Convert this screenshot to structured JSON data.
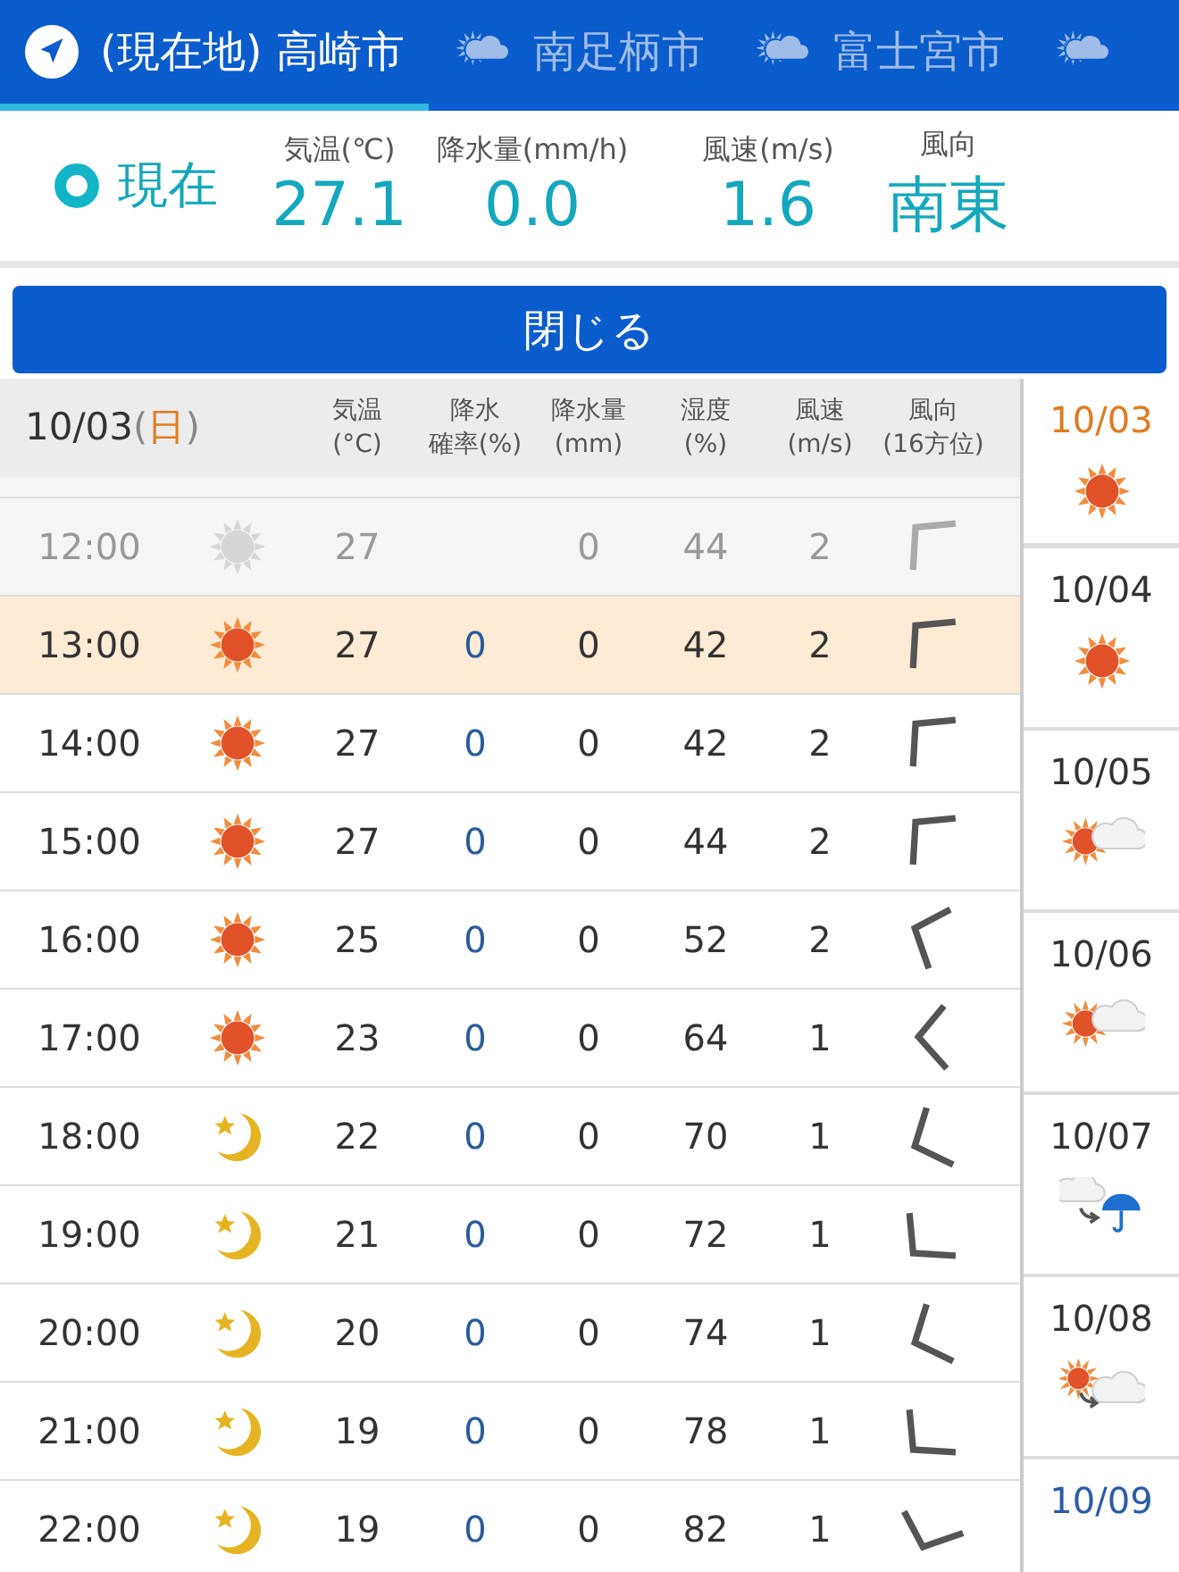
{
  "tabs": [
    {
      "label": "(現在地) 高崎市",
      "icon": {
        "kind": "location"
      },
      "selected": true
    },
    {
      "label": "南足柄市",
      "icon": {
        "kind": "sun_cloud"
      },
      "selected": false
    },
    {
      "label": "富士宮市",
      "icon": {
        "kind": "sun_cloud"
      },
      "selected": false
    },
    {
      "icon": {
        "kind": "sun_cloud"
      },
      "selected": false
    }
  ],
  "current": {
    "label": "現在",
    "stats": [
      {
        "label": "気温(℃)",
        "value": "27.1"
      },
      {
        "label": "降水量(mm/h)",
        "value": "0.0"
      },
      {
        "label": "風速(m/s)",
        "value": "1.6"
      },
      {
        "label": "風向",
        "value": "南東"
      }
    ]
  },
  "close_button": "閉じる",
  "table": {
    "date": "10/03",
    "weekday_open": "(",
    "weekday": "日",
    "weekday_close": ")",
    "columns": [
      {
        "top": "気温",
        "bottom": "(°C)"
      },
      {
        "top": "降水",
        "bottom": "確率(%)"
      },
      {
        "top": "降水量",
        "bottom": "(mm)"
      },
      {
        "top": "湿度",
        "bottom": "(%)"
      },
      {
        "top": "風速",
        "bottom": "(m/s)"
      },
      {
        "top": "風向",
        "bottom": "(16方位)"
      }
    ],
    "rows": [
      {
        "time": "12:00",
        "weather": {
          "kind": "sun"
        },
        "temp": "27",
        "amount": "0",
        "humidity": "44",
        "wind_speed": "2",
        "wind_icon": {
          "kind": "NW"
        },
        "past": true,
        "selected": false
      },
      {
        "time": "13:00",
        "weather": {
          "kind": "sun"
        },
        "temp": "27",
        "prob": "0",
        "amount": "0",
        "humidity": "42",
        "wind_speed": "2",
        "wind_icon": {
          "kind": "NW"
        },
        "past": false,
        "selected": true
      },
      {
        "time": "14:00",
        "weather": {
          "kind": "sun"
        },
        "temp": "27",
        "prob": "0",
        "amount": "0",
        "humidity": "42",
        "wind_speed": "2",
        "wind_icon": {
          "kind": "NW"
        },
        "past": false,
        "selected": false
      },
      {
        "time": "15:00",
        "weather": {
          "kind": "sun"
        },
        "temp": "27",
        "prob": "0",
        "amount": "0",
        "humidity": "44",
        "wind_speed": "2",
        "wind_icon": {
          "kind": "NW"
        },
        "past": false,
        "selected": false
      },
      {
        "time": "16:00",
        "weather": {
          "kind": "sun"
        },
        "temp": "25",
        "prob": "0",
        "amount": "0",
        "humidity": "52",
        "wind_speed": "2",
        "wind_icon": {
          "kind": "WNW"
        },
        "past": false,
        "selected": false
      },
      {
        "time": "17:00",
        "weather": {
          "kind": "sun"
        },
        "temp": "23",
        "prob": "0",
        "amount": "0",
        "humidity": "64",
        "wind_speed": "1",
        "wind_icon": {
          "kind": "W"
        },
        "past": false,
        "selected": false
      },
      {
        "time": "18:00",
        "weather": {
          "kind": "moon"
        },
        "temp": "22",
        "prob": "0",
        "amount": "0",
        "humidity": "70",
        "wind_speed": "1",
        "wind_icon": {
          "kind": "WSW"
        },
        "past": false,
        "selected": false
      },
      {
        "time": "19:00",
        "weather": {
          "kind": "moon"
        },
        "temp": "21",
        "prob": "0",
        "amount": "0",
        "humidity": "72",
        "wind_speed": "1",
        "wind_icon": {
          "kind": "SW"
        },
        "past": false,
        "selected": false
      },
      {
        "time": "20:00",
        "weather": {
          "kind": "moon"
        },
        "temp": "20",
        "prob": "0",
        "amount": "0",
        "humidity": "74",
        "wind_speed": "1",
        "wind_icon": {
          "kind": "WSW"
        },
        "past": false,
        "selected": false
      },
      {
        "time": "21:00",
        "weather": {
          "kind": "moon"
        },
        "temp": "19",
        "prob": "0",
        "amount": "0",
        "humidity": "78",
        "wind_speed": "1",
        "wind_icon": {
          "kind": "SW"
        },
        "past": false,
        "selected": false
      },
      {
        "time": "22:00",
        "weather": {
          "kind": "moon"
        },
        "temp": "19",
        "prob": "0",
        "amount": "0",
        "humidity": "82",
        "wind_speed": "1",
        "wind_icon": {
          "kind": "SSW"
        },
        "past": false,
        "selected": false
      }
    ]
  },
  "days": [
    {
      "date": "10/03",
      "weather": {
        "kind": "sun"
      },
      "color": "#e07b20",
      "selected": true
    },
    {
      "date": "10/04",
      "weather": {
        "kind": "sun"
      },
      "color": "#333333",
      "selected": false
    },
    {
      "date": "10/05",
      "weather": {
        "kind": "sun_cloud"
      },
      "color": "#333333",
      "selected": false
    },
    {
      "date": "10/06",
      "weather": {
        "kind": "sun_cloud"
      },
      "color": "#333333",
      "selected": false
    },
    {
      "date": "10/07",
      "weather": {
        "kind": "cloud_rain"
      },
      "color": "#333333",
      "selected": false
    },
    {
      "date": "10/08",
      "weather": {
        "kind": "sun_to_cloud"
      },
      "color": "#333333",
      "selected": false
    },
    {
      "date": "10/09",
      "color": "#2a5ca8",
      "selected": false
    }
  ]
}
